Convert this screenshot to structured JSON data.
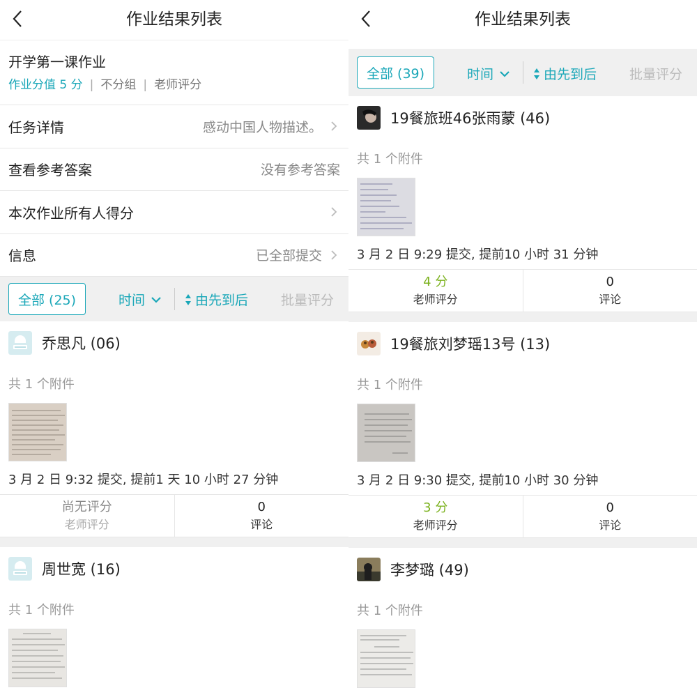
{
  "colors": {
    "accent": "#1aa7b8",
    "score_green": "#7cb21f",
    "muted": "#999999"
  },
  "icons": {
    "back": "back-chevron-icon",
    "chevron_right": "chevron-right-icon",
    "chevron_down": "chevron-down-icon",
    "sort": "sort-arrows-icon"
  },
  "left": {
    "nav_title": "作业结果列表",
    "homework": {
      "title": "开学第一课作业",
      "points": "作业分值 5 分",
      "grouping": "不分组",
      "grader": "老师评分"
    },
    "rows": [
      {
        "label": "任务详情",
        "value": "感动中国人物描述。"
      },
      {
        "label": "查看参考答案",
        "value": "没有参考答案"
      },
      {
        "label": "本次作业所有人得分",
        "value": ""
      },
      {
        "label": "信息",
        "value": "已全部提交"
      }
    ],
    "filter": {
      "all": "全部 (25)",
      "time": "时间",
      "order": "由先到后",
      "batch": "批量评分"
    },
    "cards": [
      {
        "name": "乔思凡 (06)",
        "attach": "共 1 个附件",
        "submit": "3 月 2 日 9:32 提交, 提前1 天 10 小时 27 分钟",
        "score": "尚无评分",
        "score_label": "老师评分",
        "comments": "0",
        "comments_label": "评论"
      },
      {
        "name": "周世宽 (16)",
        "attach": "共 1 个附件"
      }
    ]
  },
  "right": {
    "nav_title": "作业结果列表",
    "filter": {
      "all": "全部 (39)",
      "time": "时间",
      "order": "由先到后",
      "batch": "批量评分"
    },
    "cards": [
      {
        "name": "19餐旅班46张雨蒙 (46)",
        "attach": "共 1 个附件",
        "submit": "3 月 2 日 9:29 提交, 提前10 小时 31 分钟",
        "score": "4 分",
        "score_label": "老师评分",
        "comments": "0",
        "comments_label": "评论"
      },
      {
        "name": "19餐旅刘梦瑶13号 (13)",
        "attach": "共 1 个附件",
        "submit": "3 月 2 日 9:30 提交, 提前10 小时 30 分钟",
        "score": "3 分",
        "score_label": "老师评分",
        "comments": "0",
        "comments_label": "评论"
      },
      {
        "name": "李梦璐 (49)",
        "attach": "共 1 个附件"
      }
    ]
  }
}
